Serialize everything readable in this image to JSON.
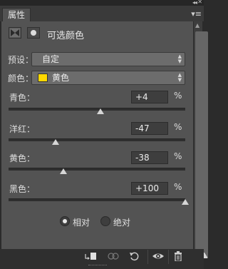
{
  "window": {
    "collapse_icon": "double-chevron-icon",
    "close_icon": "close-icon",
    "tab_label": "属性",
    "menu_icon": "panel-menu-icon"
  },
  "panel": {
    "title": "可选颜色",
    "adjustment_icon": "selective-color-icon",
    "mask_icon": "layer-mask-icon"
  },
  "preset": {
    "label": "预设：",
    "value": "自定"
  },
  "color": {
    "label": "颜色：",
    "value": "黄色",
    "swatch_color": "#ffd800"
  },
  "sliders": [
    {
      "label": "青色：",
      "value": "+4",
      "unit": "%",
      "amount": 4
    },
    {
      "label": "洋红：",
      "value": "-47",
      "unit": "%",
      "amount": -47
    },
    {
      "label": "黄色：",
      "value": "-38",
      "unit": "%",
      "amount": -38
    },
    {
      "label": "黑色：",
      "value": "+100",
      "unit": "%",
      "amount": 100
    }
  ],
  "method": {
    "options": [
      {
        "label": "相对",
        "selected": true
      },
      {
        "label": "绝对",
        "selected": false
      }
    ]
  },
  "toolbar": {
    "buttons": [
      "clip-to-layer-icon",
      "view-previous-icon",
      "reset-icon",
      "visibility-eye-icon",
      "trash-icon"
    ]
  }
}
